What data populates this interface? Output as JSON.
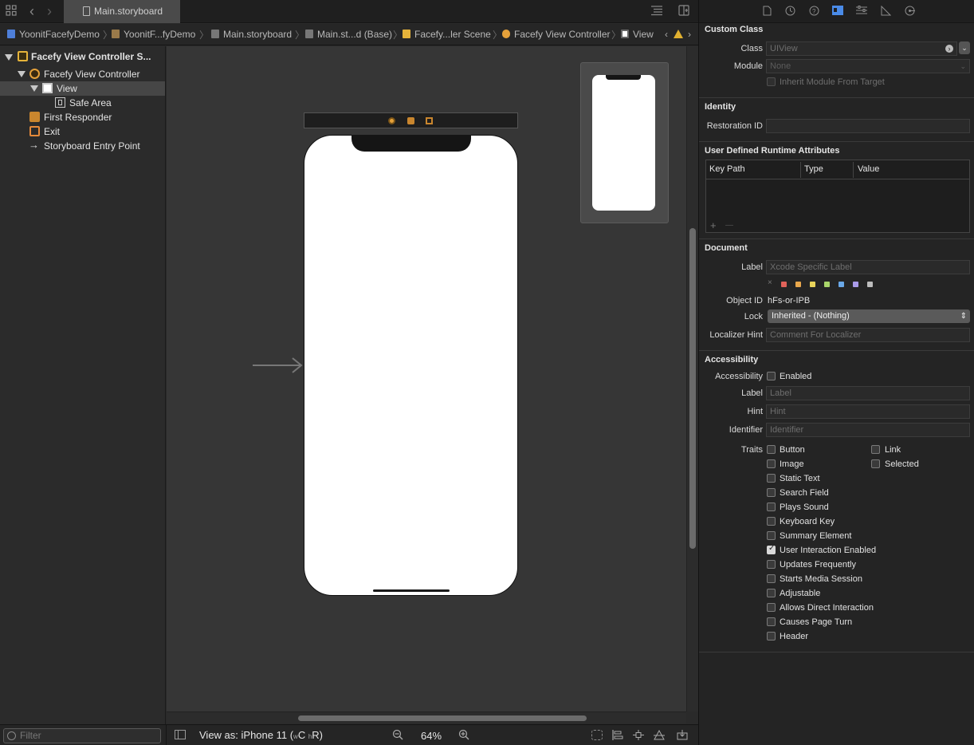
{
  "tab": {
    "title": "Main.storyboard"
  },
  "breadcrumbs": [
    {
      "label": "YoonitFacefyDemo",
      "color": "#4e7fd9"
    },
    {
      "label": "YoonitF...fyDemo",
      "color": "#9a7a4a"
    },
    {
      "label": "Main.storyboard",
      "color": "#b5b5b5"
    },
    {
      "label": "Main.st...d (Base)",
      "color": "#b5b5b5"
    },
    {
      "label": "Facefy...ler Scene",
      "color": "#e5b33a"
    },
    {
      "label": "Facefy View Controller",
      "color": "#e5a13a"
    },
    {
      "label": "View",
      "color": "#d0d0d0"
    }
  ],
  "outline": {
    "items": [
      {
        "label": "Facefy View Controller S...",
        "bold": true
      },
      {
        "label": "Facefy View Controller"
      },
      {
        "label": "View",
        "selected": true
      },
      {
        "label": "Safe Area"
      },
      {
        "label": "First Responder"
      },
      {
        "label": "Exit"
      },
      {
        "label": "Storyboard Entry Point"
      }
    ],
    "filter_placeholder": "Filter"
  },
  "bottombar": {
    "view_as": "View as: iPhone 11 (",
    "size_w": "w",
    "size_c": "C ",
    "size_h": "h",
    "size_r": "R)",
    "zoom": "64%"
  },
  "inspector": {
    "custom_class": {
      "title": "Custom Class",
      "class_label": "Class",
      "class_value": "UIView",
      "module_label": "Module",
      "module_value": "None",
      "inherit_label": "Inherit Module From Target"
    },
    "identity": {
      "title": "Identity",
      "restoration_label": "Restoration ID",
      "restoration_value": ""
    },
    "runtime": {
      "title": "User Defined Runtime Attributes",
      "columns": [
        "Key Path",
        "Type",
        "Value"
      ],
      "add": "+",
      "remove": "—"
    },
    "document": {
      "title": "Document",
      "label_label": "Label",
      "label_placeholder": "Xcode Specific Label",
      "clear_glyph": "×",
      "colors": [
        "#e0625a",
        "#e8a74c",
        "#e8d35a",
        "#a9d66a",
        "#6aa8e8",
        "#a99be8",
        "#bdbdbd"
      ],
      "object_id_label": "Object ID",
      "object_id_value": "hFs-or-IPB",
      "lock_label": "Lock",
      "lock_value": "Inherited - (Nothing)",
      "localizer_label": "Localizer Hint",
      "localizer_placeholder": "Comment For Localizer"
    },
    "accessibility": {
      "title": "Accessibility",
      "accessibility_label": "Accessibility",
      "enabled_label": "Enabled",
      "label_label": "Label",
      "label_placeholder": "Label",
      "hint_label": "Hint",
      "hint_placeholder": "Hint",
      "identifier_label": "Identifier",
      "identifier_placeholder": "Identifier",
      "traits_label": "Traits",
      "traits": [
        {
          "label": "Button",
          "checked": false
        },
        {
          "label": "Image",
          "checked": false
        },
        {
          "label": "Static Text",
          "checked": false
        },
        {
          "label": "Search Field",
          "checked": false
        },
        {
          "label": "Plays Sound",
          "checked": false
        },
        {
          "label": "Keyboard Key",
          "checked": false
        },
        {
          "label": "Summary Element",
          "checked": false
        },
        {
          "label": "User Interaction Enabled",
          "checked": true
        },
        {
          "label": "Updates Frequently",
          "checked": false
        },
        {
          "label": "Starts Media Session",
          "checked": false
        },
        {
          "label": "Adjustable",
          "checked": false
        },
        {
          "label": "Allows Direct Interaction",
          "checked": false
        },
        {
          "label": "Causes Page Turn",
          "checked": false
        },
        {
          "label": "Header",
          "checked": false
        }
      ],
      "traits_right": [
        {
          "label": "Link",
          "checked": false
        },
        {
          "label": "Selected",
          "checked": false
        }
      ]
    }
  }
}
